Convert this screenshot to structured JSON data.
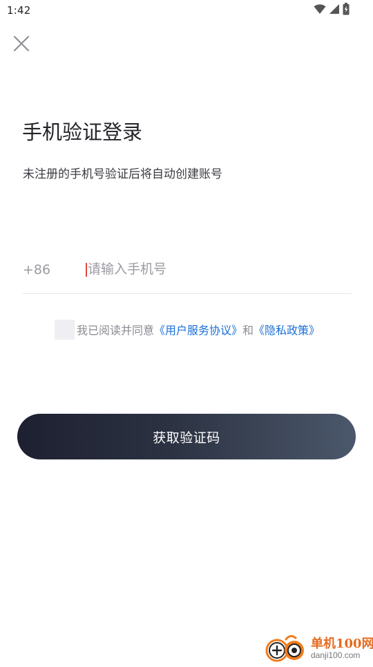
{
  "status_bar": {
    "time": "1:42",
    "icons": [
      "wifi-icon",
      "signal-icon",
      "battery-charging-icon"
    ]
  },
  "header": {
    "close_icon": "close-icon"
  },
  "title": "手机验证登录",
  "subtitle": "未注册的手机号验证后将自动创建账号",
  "phone": {
    "country_code": "+86",
    "placeholder": "请输入手机号",
    "value": ""
  },
  "agreement": {
    "checked": false,
    "prefix": "我已阅读并同意",
    "terms_link": "《用户服务协议》",
    "conjunction": "和",
    "privacy_link": "《隐私政策》"
  },
  "primary_button": {
    "label": "获取验证码"
  },
  "watermark": {
    "brand": "单机100网",
    "domain": "danji100.com"
  },
  "colors": {
    "link": "#1a6fd6",
    "caret": "#e2463c",
    "button_gradient_start": "#1d2030",
    "button_gradient_end": "#4b586b"
  }
}
